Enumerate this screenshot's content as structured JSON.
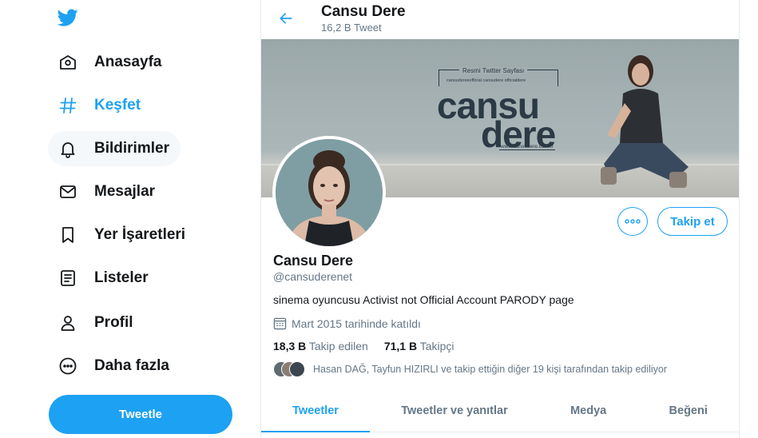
{
  "brand": {
    "logo": "twitter-bird-icon",
    "accent": "#1da1f2"
  },
  "sidebar": {
    "items": [
      {
        "label": "Anasayfa",
        "icon": "home-icon"
      },
      {
        "label": "Keşfet",
        "icon": "hashtag-icon",
        "active": true
      },
      {
        "label": "Bildirimler",
        "icon": "bell-icon"
      },
      {
        "label": "Mesajlar",
        "icon": "envelope-icon"
      },
      {
        "label": "Yer İşaretleri",
        "icon": "bookmark-icon"
      },
      {
        "label": "Listeler",
        "icon": "list-icon"
      },
      {
        "label": "Profil",
        "icon": "person-icon"
      },
      {
        "label": "Daha fazla",
        "icon": "more-circle-icon"
      }
    ],
    "tweet_button": "Tweetle"
  },
  "header": {
    "name": "Cansu Dere",
    "tweet_count": "16,2 B Tweet"
  },
  "banner": {
    "subtitle": "Resmi Twitter Sayfası",
    "handles": "cansuderesofficial   cansudere   officialdere",
    "word1": "cansu",
    "word2": "dere",
    "url": "www.cansudere.com.tr"
  },
  "profile": {
    "name": "Cansu Dere",
    "handle": "@cansuderenet",
    "bio": "sinema oyuncusu Activist not Official Account PARODY page",
    "joined": "Mart 2015 tarihinde katıldı",
    "following_count": "18,3 B",
    "following_label": "Takip edilen",
    "followers_count": "71,1 B",
    "followers_label": "Takipçi",
    "followed_by": "Hasan DAĞ, Tayfun HIZIRLI ve takip ettiğin diğer 19 kişi tarafından takip ediliyor",
    "follow_button": "Takip et"
  },
  "tabs": [
    {
      "label": "Tweetler",
      "active": true
    },
    {
      "label": "Tweetler ve yanıtlar"
    },
    {
      "label": "Medya"
    },
    {
      "label": "Beğeni"
    }
  ]
}
